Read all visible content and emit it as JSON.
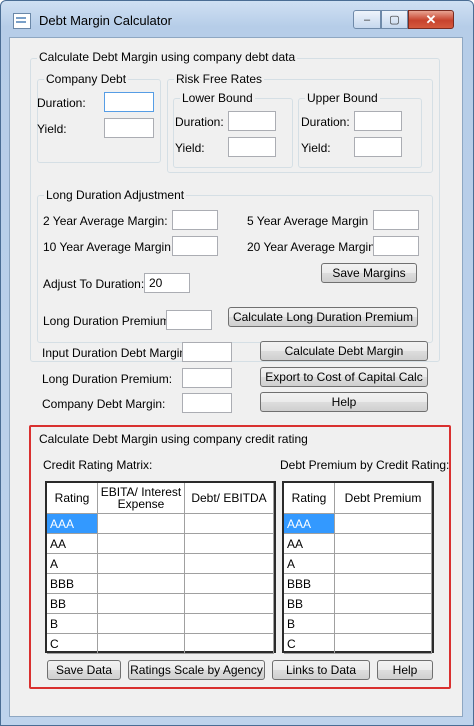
{
  "window": {
    "title": "Debt Margin Calculator",
    "minimize_glyph": "–",
    "maximize_glyph": "▢",
    "close_glyph": "✕",
    "accent_color": "#c7432d",
    "highlight_color": "#d9302f",
    "selection_color": "#3399ff"
  },
  "debt_data": {
    "group_title": "Calculate Debt Margin using company debt data",
    "company_debt": {
      "title": "Company Debt",
      "duration_label": "Duration:",
      "duration_value": "",
      "yield_label": "Yield:",
      "yield_value": ""
    },
    "risk_free": {
      "title": "Risk Free Rates",
      "lower": {
        "title": "Lower Bound",
        "duration_label": "Duration:",
        "duration_value": "",
        "yield_label": "Yield:",
        "yield_value": ""
      },
      "upper": {
        "title": "Upper Bound",
        "duration_label": "Duration:",
        "duration_value": "",
        "yield_label": "Yield:",
        "yield_value": ""
      }
    },
    "long_duration": {
      "title": "Long Duration Adjustment",
      "two_year_label": "2 Year Average Margin:",
      "two_year_value": "",
      "ten_year_label": "10 Year Average Margin",
      "ten_year_value": "",
      "five_year_label": "5 Year Average Margin",
      "five_year_value": "",
      "twenty_year_label": "20 Year Average Margin",
      "twenty_year_value": "",
      "adjust_label": "Adjust To Duration:",
      "adjust_value": "20",
      "save_margins_label": "Save Margins",
      "premium_label": "Long Duration Premium:",
      "premium_value": "",
      "calc_premium_label": "Calculate Long Duration Premium"
    },
    "input_margin_label": "Input Duration Debt Margin:",
    "input_margin_value": "",
    "ld_premium_label": "Long Duration Premium:",
    "ld_premium_value": "",
    "company_margin_label": "Company Debt Margin:",
    "company_margin_value": "",
    "calc_margin_label": "Calculate Debt Margin",
    "export_label": "Export to Cost of Capital Calc",
    "help_label": "Help"
  },
  "credit_rating": {
    "group_title": "Calculate Debt Margin using company credit rating",
    "matrix_label": "Credit Rating Matrix:",
    "premium_label": "Debt Premium by Credit Rating:",
    "matrix_headers": [
      "Rating",
      "EBITA/ Interest Expense",
      "Debt/ EBITDA"
    ],
    "premium_headers": [
      "Rating",
      "Debt Premium"
    ],
    "ratings": [
      "AAA",
      "AA",
      "A",
      "BBB",
      "BB",
      "B",
      "C"
    ],
    "selected_rating": "AAA",
    "save_label": "Save Data",
    "scale_label": "Ratings Scale by Agency",
    "links_label": "Links to Data",
    "help_label": "Help"
  }
}
